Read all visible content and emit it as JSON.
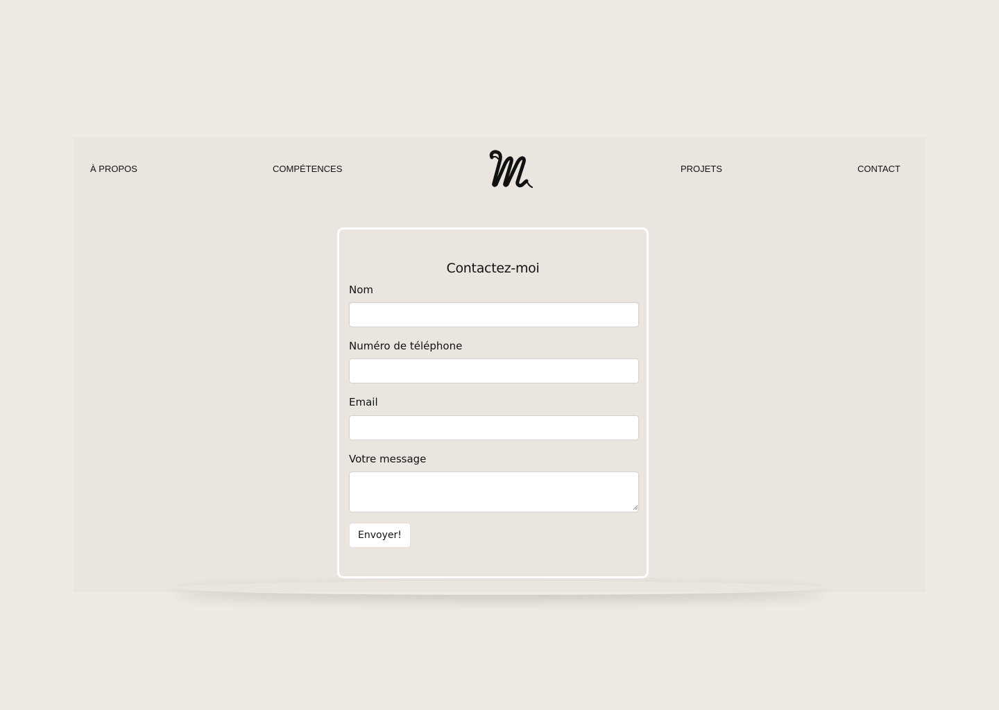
{
  "nav": {
    "items": [
      {
        "label": "À PROPOS"
      },
      {
        "label": "COMPÉTENCES"
      },
      {
        "label": "PROJETS"
      },
      {
        "label": "CONTACT"
      }
    ],
    "logo_icon": "script-m-logo"
  },
  "form": {
    "title": "Contactez-moi",
    "fields": [
      {
        "label": "Nom",
        "value": "",
        "placeholder": ""
      },
      {
        "label": "Numéro de téléphone",
        "value": "",
        "placeholder": ""
      },
      {
        "label": "Email",
        "value": "",
        "placeholder": ""
      },
      {
        "label": "Votre message",
        "value": "",
        "placeholder": ""
      }
    ],
    "submit_label": "Envoyer!"
  },
  "colors": {
    "page_background": "#efebe4",
    "frame_background": "#eae6df",
    "card_border": "#ffffff",
    "text": "#111111"
  }
}
